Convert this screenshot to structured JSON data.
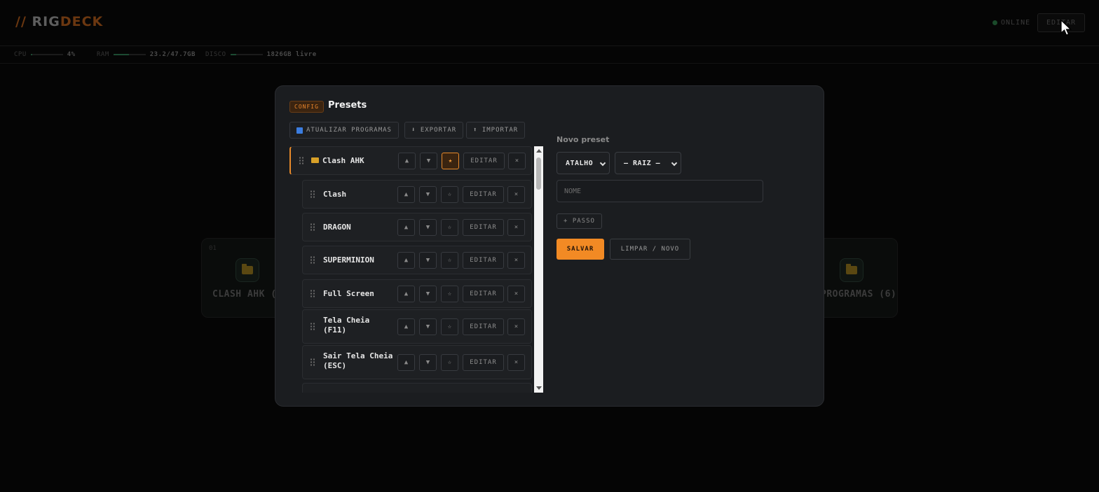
{
  "header": {
    "logo_slash": "//",
    "logo_rig": "RIG",
    "logo_deck": "DECK",
    "status": "ONLINE",
    "edit_label": "EDITAR"
  },
  "stats": {
    "cpu_label": "CPU",
    "cpu_value": "4%",
    "cpu_level": 0.04,
    "ram_label": "RAM",
    "ram_value": "23.2/47.7GB",
    "ram_level": 0.49,
    "disk_label": "DISCO",
    "disk_value": "1826GB livre",
    "disk_level": 0.18
  },
  "background_cards": [
    {
      "num": "01",
      "label": "CLASH AHK (7"
    },
    {
      "num": "",
      "label": "PROGRAMAS (6)"
    }
  ],
  "modal": {
    "tag": "CONFIG",
    "title": "Presets",
    "toolbar": {
      "update": "ATUALIZAR PROGRAMAS",
      "export": "⬇ EXPORTAR",
      "import": "⬆ IMPORTAR"
    },
    "rows": [
      {
        "name": "Clash AHK",
        "folder": true,
        "starred": true
      },
      {
        "name": "Clash"
      },
      {
        "name": "DRAGON"
      },
      {
        "name": "SUPERMINION"
      },
      {
        "name": "Full Screen"
      },
      {
        "name": "Tela Cheia (F11)"
      },
      {
        "name": "Sair Tela Cheia (ESC)"
      }
    ],
    "row_controls": {
      "up": "▲",
      "down": "▼",
      "star_on": "★",
      "star_off": "☆",
      "edit": "EDITAR",
      "remove": "×"
    },
    "form": {
      "title": "Novo preset",
      "type_value": "ATALHO",
      "parent_value": "— RAIZ —",
      "name_placeholder": "NOME",
      "add_step": "+ PASSO",
      "save": "SALVAR",
      "clear": "LIMPAR / NOVO"
    }
  }
}
